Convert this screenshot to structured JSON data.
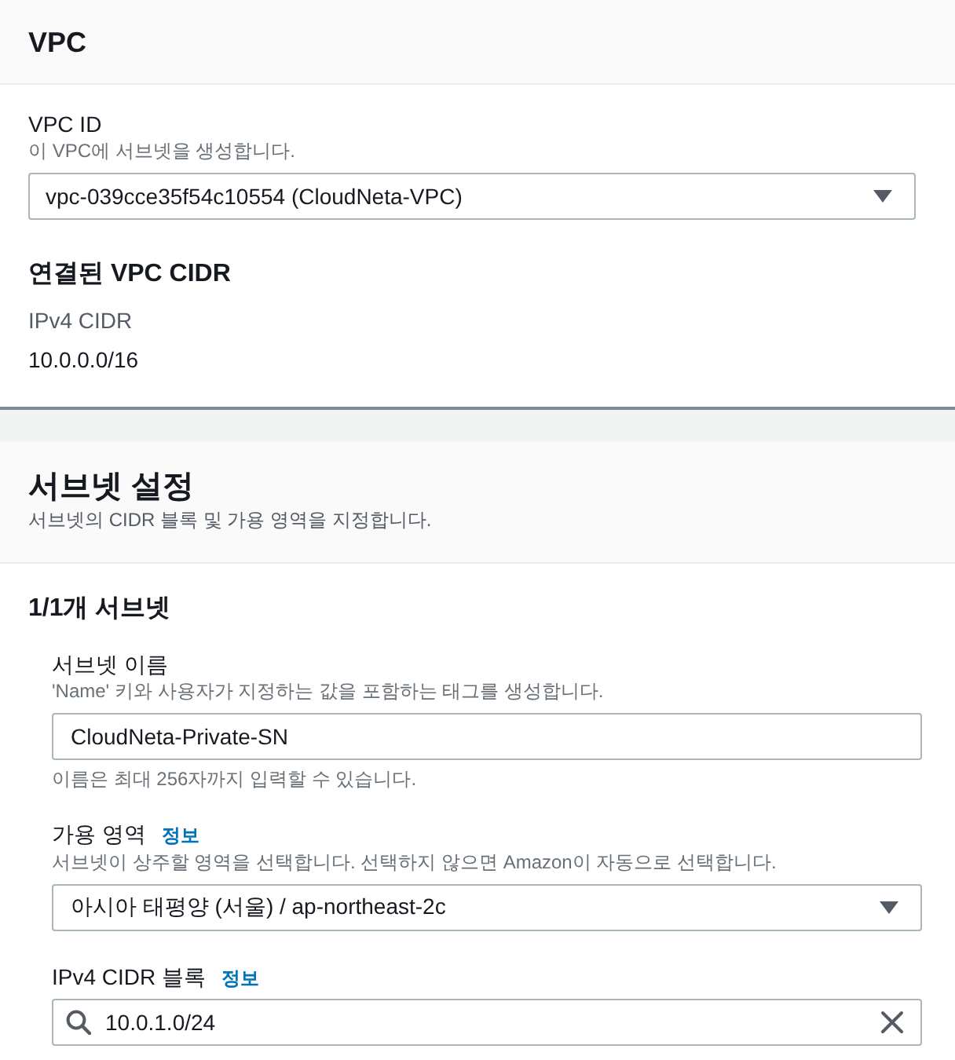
{
  "vpc_panel": {
    "title": "VPC",
    "vpc_id": {
      "label": "VPC ID",
      "description": "이 VPC에 서브넷을 생성합니다.",
      "value": "vpc-039cce35f54c10554 (CloudNeta-VPC)"
    },
    "associated_cidr": {
      "heading": "연결된 VPC CIDR",
      "label": "IPv4 CIDR",
      "value": "10.0.0.0/16"
    }
  },
  "subnet_settings": {
    "title": "서브넷 설정",
    "description": "서브넷의 CIDR 블록 및 가용 영역을 지정합니다.",
    "subnet_heading": "1/1개 서브넷",
    "fields": [
      {
        "kind": "text",
        "label": "서브넷 이름",
        "description": "'Name' 키와 사용자가 지정하는 값을 포함하는 태그를 생성합니다.",
        "value": "CloudNeta-Private-SN",
        "hint": "이름은 최대 256자까지 입력할 수 있습니다."
      },
      {
        "kind": "select",
        "label": "가용 영역",
        "info_link": "정보",
        "description": "서브넷이 상주할 영역을 선택합니다. 선택하지 않으면 Amazon이 자동으로 선택합니다.",
        "value": "아시아 태평양 (서울) / ap-northeast-2c"
      },
      {
        "kind": "search",
        "label": "IPv4 CIDR 블록",
        "info_link": "정보",
        "value": "10.0.1.0/24"
      }
    ]
  }
}
